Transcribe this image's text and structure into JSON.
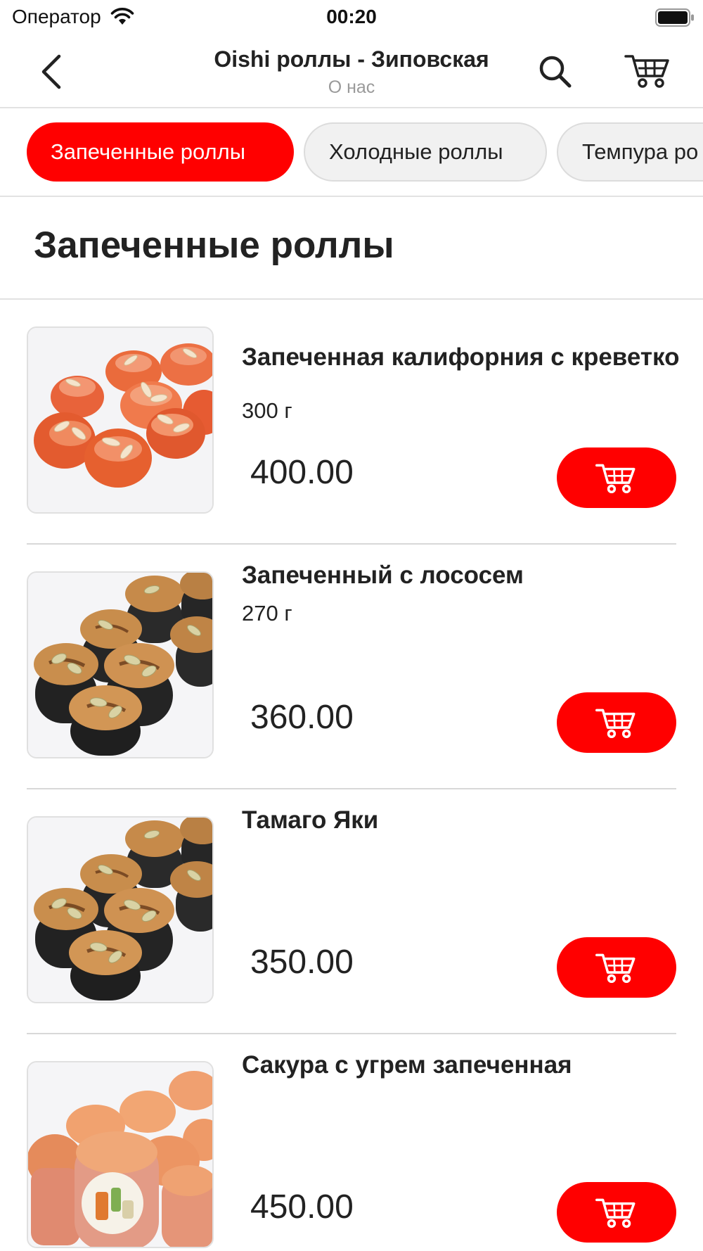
{
  "status_bar": {
    "carrier": "Оператор",
    "time": "00:20"
  },
  "nav": {
    "title": "Oishi роллы - Зиповская",
    "subtitle": "О нас",
    "icons": {
      "back": "chevron-left-icon",
      "search": "search-icon",
      "cart": "cart-icon"
    }
  },
  "categories": [
    {
      "label": "Запеченные роллы",
      "active": true
    },
    {
      "label": "Холодные роллы",
      "active": false
    },
    {
      "label": "Темпура ро",
      "active": false
    }
  ],
  "section": {
    "title": "Запеченные роллы"
  },
  "products": [
    {
      "name": "Запеченная калифорния с креветко",
      "weight": "300 г",
      "price": "400.00",
      "image": "orange-baked-rolls"
    },
    {
      "name": "Запеченный с лососем",
      "weight": "270 г",
      "price": "360.00",
      "image": "nori-baked-rolls"
    },
    {
      "name": "Тамаго Яки",
      "weight": "",
      "price": "350.00",
      "image": "nori-baked-rolls"
    },
    {
      "name": "Сакура с угрем запеченная",
      "weight": "",
      "price": "450.00",
      "image": "pink-baked-rolls"
    }
  ],
  "colors": {
    "accent": "#ff0000",
    "text": "#222222",
    "muted": "#9a9a9a",
    "divider": "#e2e2e2",
    "chip_bg": "#f1f1f1"
  }
}
